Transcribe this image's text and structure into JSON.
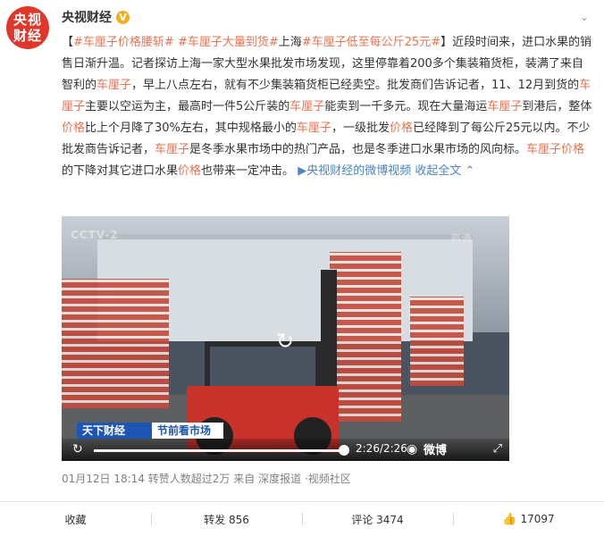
{
  "author": {
    "avatar_text_line1": "央视",
    "avatar_text_line2": "财经",
    "name": "央视财经",
    "verified_icon": "verified-badge-icon"
  },
  "post": {
    "tag_open": "【",
    "hashtag1": "#车厘子价格腰斩#",
    "hashtag2": "#车厘子大量到货#",
    "prefix3": "上海",
    "hashtag3": "#车厘子低至每公斤25元#",
    "tag_close": "】",
    "p1": "近段时间来，进口水果的销售日渐升温。记者探访上海一家大型水果批发市场发现，这里停靠着200多个集装箱货柜，装满了来自智利的",
    "hl1": "车厘子",
    "p2": "，早上八点左右，就有不少集装箱货柜已经卖空。批发商们告诉记者，11、12月到货的",
    "hl2": "车厘子",
    "p3": "主要以空运为主，最高时一件5公斤装的",
    "hl3": "车厘子",
    "p4": "能卖到一千多元。现在大量海运",
    "hl4": "车厘子",
    "p5": "到港后，整体",
    "hl5": "价格",
    "p6": "比上个月降了30%左右，其中规格最小的",
    "hl6": "车厘子",
    "p7": "，一级批发",
    "hl7": "价格",
    "p8": "已经降到了每公斤25元以内。不少批发商告诉记者，",
    "hl8": "车厘子",
    "p9": "是冬季水果市场中的热门产品，也是冬季进口水果市场的风向标。",
    "hl9": "车厘子价格",
    "p10": "的下降对其它进口水果",
    "hl10": "价格",
    "p11": "也带来一定冲击。",
    "video_link": "央视财经的微博视频",
    "expand": "收起全文",
    "expand_icon": "chevron-up-icon"
  },
  "video": {
    "watermark": "CCTV-2",
    "quality": "高清",
    "program_tag": "天下财经",
    "segment_tag": "节前看市场",
    "time": "2:26/2:26",
    "brand": "微博",
    "progress": 1.0
  },
  "meta": {
    "date": "01月12日 18:14",
    "reposts": "转赞人数超过2万",
    "source_prefix": "来自",
    "source1": "深度报道",
    "sep": "·",
    "source2": "视频社区"
  },
  "actions": {
    "favorite": "收藏",
    "repost": "转发 856",
    "comment": "评论 3474",
    "like": "17097"
  }
}
